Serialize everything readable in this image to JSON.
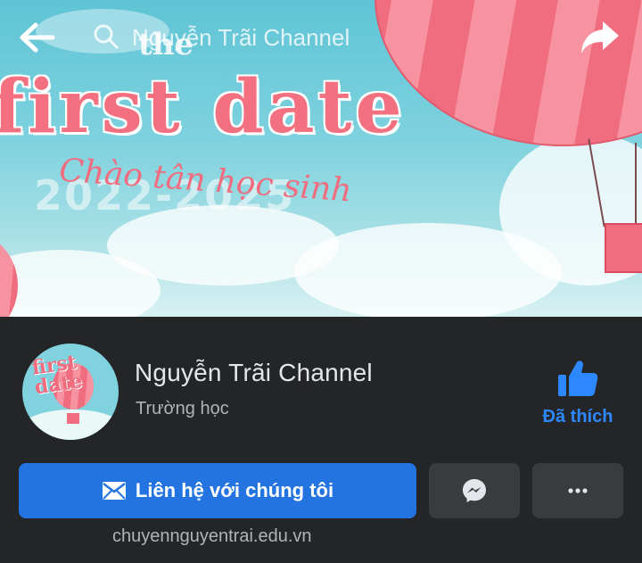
{
  "header": {
    "search_text": "Nguyễn Trãi Channel"
  },
  "cover": {
    "art_label_small": "the",
    "art_title": "first date",
    "art_years": "2022-2025",
    "art_script": "Chào tân học sinh"
  },
  "profile": {
    "name": "Nguyễn Trãi Channel",
    "category": "Trường học",
    "avatar_text": "first date"
  },
  "like": {
    "label": "Đã thích",
    "icon": "thumbs-up-icon"
  },
  "actions": {
    "contact_label": "Liên hệ với chúng tôi",
    "contact_icon": "mail-icon",
    "messenger_icon": "messenger-icon",
    "more_icon": "more-horizontal-icon"
  },
  "website": "chuyennguyentrai.edu.vn",
  "colors": {
    "background": "#242526",
    "accent": "#2374e1",
    "like_text": "#2d88ff",
    "secondary_button": "#3a3b3c"
  }
}
